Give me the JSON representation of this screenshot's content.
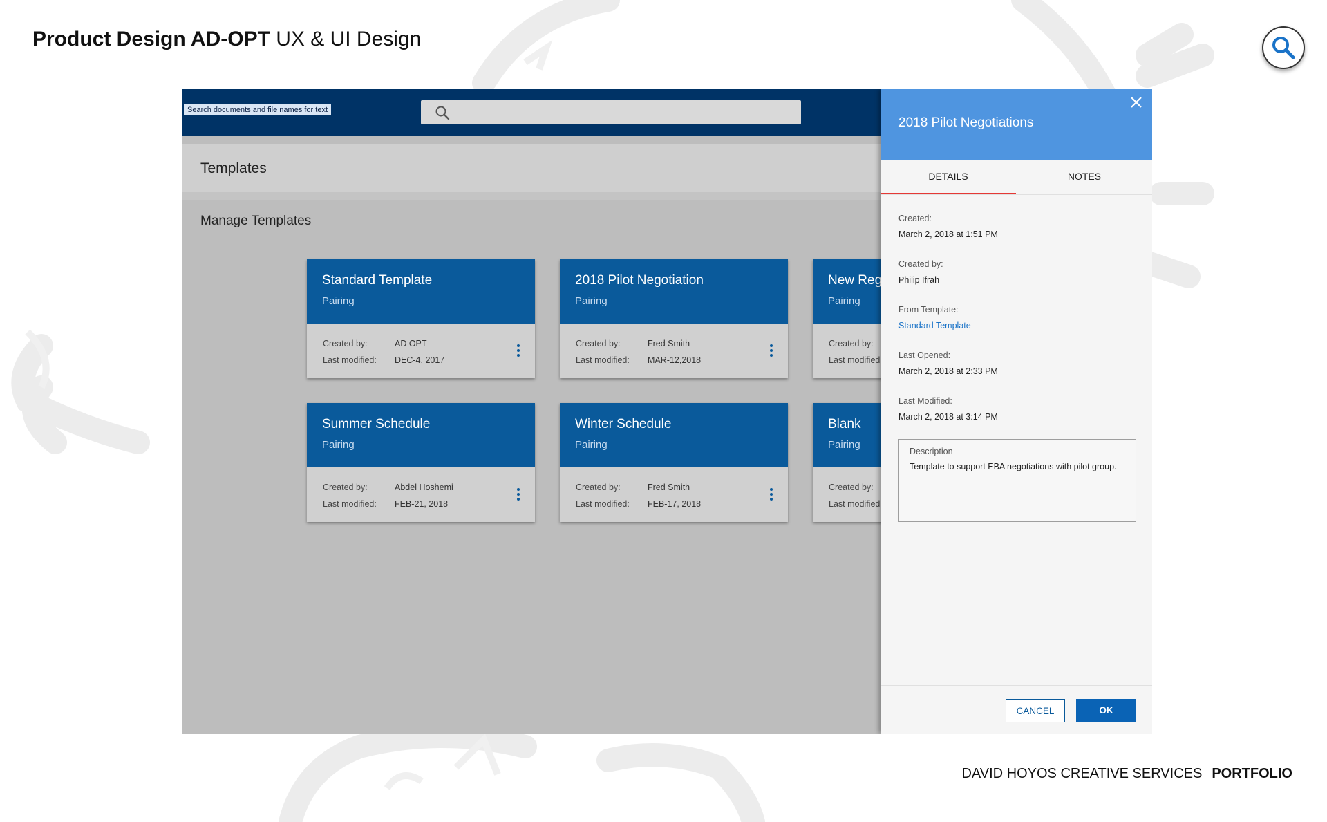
{
  "page": {
    "title_bold": "Product Design AD-OPT",
    "title_rest": " UX & UI Design",
    "footer_left": "DAVID HOYOS CREATIVE SERVICES",
    "footer_right": "PORTFOLIO"
  },
  "topbar": {
    "search_tooltip": "Search documents and file names for text",
    "search_placeholder": ""
  },
  "templates": {
    "section_title": "Templates",
    "manage_title": "Manage Templates",
    "created_by_label": "Created by:",
    "last_modified_label": "Last modified:",
    "cards": [
      {
        "name": "Standard Template",
        "type": "Pairing",
        "created_by": "AD OPT",
        "last_modified": "DEC-4, 2017"
      },
      {
        "name": "2018 Pilot Negotiation",
        "type": "Pairing",
        "created_by": "Fred Smith",
        "last_modified": "MAR-12,2018"
      },
      {
        "name": "New Regu",
        "type": "Pairing",
        "created_by": "",
        "last_modified": ""
      },
      {
        "name": "Summer Schedule",
        "type": "Pairing",
        "created_by": "Abdel Hoshemi",
        "last_modified": "FEB-21, 2018"
      },
      {
        "name": "Winter Schedule",
        "type": "Pairing",
        "created_by": "Fred Smith",
        "last_modified": "FEB-17, 2018"
      },
      {
        "name": "Blank",
        "type": "Pairing",
        "created_by": "",
        "last_modified": ""
      }
    ]
  },
  "panel": {
    "title": "2018 Pilot Negotiations",
    "tabs": [
      "DETAILS",
      "NOTES"
    ],
    "active_tab": "DETAILS",
    "fields": [
      {
        "label": "Created:",
        "value": "March 2, 2018 at 1:51 PM"
      },
      {
        "label": "Created by:",
        "value": "Philip Ifrah"
      },
      {
        "label": "From Template:",
        "value": "Standard Template"
      },
      {
        "label": "Last Opened:",
        "value": "March 2, 2018 at 2:33 PM"
      },
      {
        "label": "Last Modified:",
        "value": "March 2, 2018 at 3:14 PM"
      }
    ],
    "description_label": "Description",
    "description_text": "Template to support EBA negotiations with pilot group.",
    "cancel_label": "CANCEL",
    "ok_label": "OK"
  },
  "colors": {
    "topbar": "#003366",
    "card_header": "#0a5a9b",
    "panel_header": "#4f95e0",
    "tab_indicator": "#e53935",
    "link": "#1a73c8"
  }
}
